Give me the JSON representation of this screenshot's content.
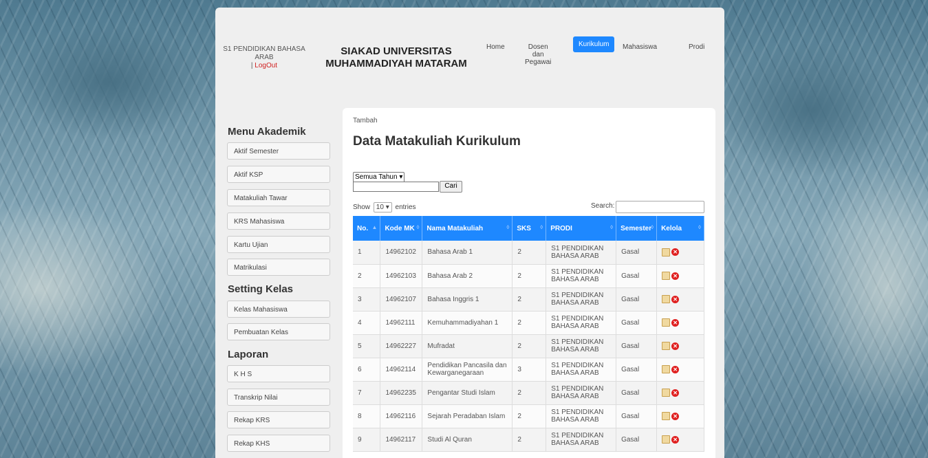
{
  "header": {
    "user_program": "S1 PENDIDIKAN BAHASA ARAB",
    "separator": "|",
    "logout_label": "LogOut",
    "brand_line1": "SIAKAD UNIVERSITAS",
    "brand_line2": "MUHAMMADIYAH MATARAM"
  },
  "nav": {
    "home": "Home",
    "dosen_l1": "Dosen",
    "dosen_l2": "dan",
    "dosen_l3": "Pegawai",
    "kurikulum": "Kurikulum",
    "mahasiswa": "Mahasiswa",
    "prodi": "Prodi"
  },
  "sidebar": {
    "section1": "Menu Akademik",
    "items1": [
      "Aktif Semester",
      "Aktif KSP",
      "Matakuliah Tawar",
      "KRS Mahasiswa",
      "Kartu Ujian",
      "Matrikulasi"
    ],
    "section2": "Setting Kelas",
    "items2": [
      "Kelas Mahasiswa",
      "Pembuatan Kelas"
    ],
    "section3": "Laporan",
    "items3": [
      "K H S",
      "Transkrip Nilai",
      "Rekap KRS",
      "Rekap KHS"
    ]
  },
  "main": {
    "tambah": "Tambah",
    "title": "Data Matakuliah Kurikulum",
    "year_select": "Semua Tahun",
    "cari": "Cari",
    "show": "Show",
    "entries_value": "10",
    "entries": "entries",
    "search_label": "Search:"
  },
  "table": {
    "headers": [
      "No.",
      "Kode MK",
      "Nama Matakuliah",
      "SKS",
      "PRODI",
      "Semester",
      "Kelola"
    ],
    "rows": [
      [
        "1",
        "14962102",
        "Bahasa Arab 1",
        "2",
        "S1 PENDIDIKAN BAHASA ARAB",
        "Gasal"
      ],
      [
        "2",
        "14962103",
        "Bahasa Arab 2",
        "2",
        "S1 PENDIDIKAN BAHASA ARAB",
        "Gasal"
      ],
      [
        "3",
        "14962107",
        "Bahasa Inggris 1",
        "2",
        "S1 PENDIDIKAN BAHASA ARAB",
        "Gasal"
      ],
      [
        "4",
        "14962111",
        "Kemuhammadiyahan 1",
        "2",
        "S1 PENDIDIKAN BAHASA ARAB",
        "Gasal"
      ],
      [
        "5",
        "14962227",
        "Mufradat",
        "2",
        "S1 PENDIDIKAN BAHASA ARAB",
        "Gasal"
      ],
      [
        "6",
        "14962114",
        "Pendidikan Pancasila dan Kewarganegaraan",
        "3",
        "S1 PENDIDIKAN BAHASA ARAB",
        "Gasal"
      ],
      [
        "7",
        "14962235",
        "Pengantar Studi Islam",
        "2",
        "S1 PENDIDIKAN BAHASA ARAB",
        "Gasal"
      ],
      [
        "8",
        "14962116",
        "Sejarah Peradaban Islam",
        "2",
        "S1 PENDIDIKAN BAHASA ARAB",
        "Gasal"
      ],
      [
        "9",
        "14962117",
        "Studi Al Quran",
        "2",
        "S1 PENDIDIKAN BAHASA ARAB",
        "Gasal"
      ]
    ]
  },
  "icons": {
    "edit": "edit-icon",
    "delete": "delete-icon",
    "sort": "sort-icon",
    "dropdown": "chevron-down-icon"
  },
  "colors": {
    "accent": "#1e88ff",
    "logout": "#d02020"
  }
}
